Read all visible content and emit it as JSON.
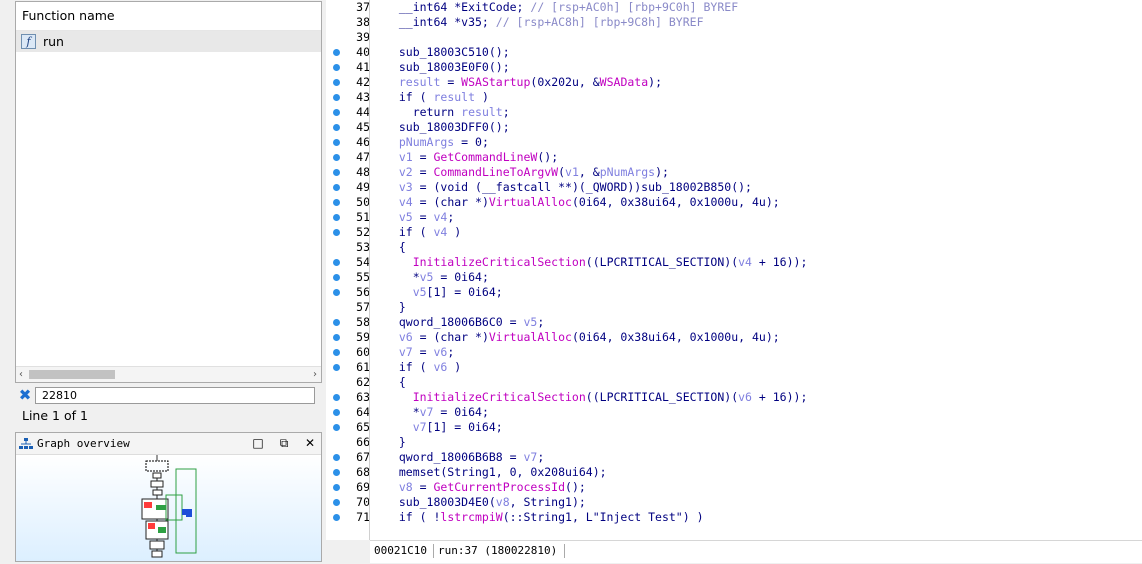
{
  "function_list": {
    "header": "Function name",
    "items": [
      {
        "name": "run",
        "icon": "function-icon"
      }
    ]
  },
  "search": {
    "value": "22810"
  },
  "line_info": "Line 1 of 1",
  "graph_overview": {
    "title": "Graph overview",
    "buttons": [
      "maximize",
      "restore",
      "close"
    ]
  },
  "status_bar": {
    "offset": "00021C10",
    "position": "run:37 (180022810)"
  },
  "colors": {
    "keyword": "#000080",
    "comment": "#8a8ac8",
    "variable": "#7f7fdf",
    "api": "#c000c0",
    "breakpoint": "#2b90e8"
  },
  "code_lines": [
    {
      "n": "37",
      "dot": false,
      "seg": [
        [
          "p",
          "  __int64 *ExitCode; "
        ],
        [
          "c",
          "// [rsp+AC0h] [rbp+9C0h] BYREF"
        ]
      ]
    },
    {
      "n": "38",
      "dot": false,
      "seg": [
        [
          "p",
          "  __int64 *v35; "
        ],
        [
          "c",
          "// [rsp+AC8h] [rbp+9C8h] BYREF"
        ]
      ]
    },
    {
      "n": "39",
      "dot": false,
      "seg": []
    },
    {
      "n": "40",
      "dot": true,
      "seg": [
        [
          "p",
          "  sub_18003C510();"
        ]
      ]
    },
    {
      "n": "41",
      "dot": true,
      "seg": [
        [
          "p",
          "  sub_18003E0F0();"
        ]
      ]
    },
    {
      "n": "42",
      "dot": true,
      "seg": [
        [
          "v",
          "  result"
        ],
        [
          "p",
          " = "
        ],
        [
          "f",
          "WSAStartup"
        ],
        [
          "p",
          "(0x202u, &"
        ],
        [
          "f",
          "WSAData"
        ],
        [
          "p",
          ");"
        ]
      ]
    },
    {
      "n": "43",
      "dot": true,
      "seg": [
        [
          "p",
          "  if ( "
        ],
        [
          "v",
          "result"
        ],
        [
          "p",
          " )"
        ]
      ]
    },
    {
      "n": "44",
      "dot": true,
      "seg": [
        [
          "p",
          "    return "
        ],
        [
          "v",
          "result"
        ],
        [
          "p",
          ";"
        ]
      ]
    },
    {
      "n": "45",
      "dot": true,
      "seg": [
        [
          "p",
          "  sub_18003DFF0();"
        ]
      ]
    },
    {
      "n": "46",
      "dot": true,
      "seg": [
        [
          "v",
          "  pNumArgs"
        ],
        [
          "p",
          " = 0;"
        ]
      ]
    },
    {
      "n": "47",
      "dot": true,
      "seg": [
        [
          "v",
          "  v1"
        ],
        [
          "p",
          " = "
        ],
        [
          "f",
          "GetCommandLineW"
        ],
        [
          "p",
          "();"
        ]
      ]
    },
    {
      "n": "48",
      "dot": true,
      "seg": [
        [
          "v",
          "  v2"
        ],
        [
          "p",
          " = "
        ],
        [
          "f",
          "CommandLineToArgvW"
        ],
        [
          "p",
          "("
        ],
        [
          "v",
          "v1"
        ],
        [
          "p",
          ", &"
        ],
        [
          "v",
          "pNumArgs"
        ],
        [
          "p",
          ");"
        ]
      ]
    },
    {
      "n": "49",
      "dot": true,
      "seg": [
        [
          "v",
          "  v3"
        ],
        [
          "p",
          " = (void (__fastcall **)(_QWORD))sub_18002B850();"
        ]
      ]
    },
    {
      "n": "50",
      "dot": true,
      "seg": [
        [
          "v",
          "  v4"
        ],
        [
          "p",
          " = (char *)"
        ],
        [
          "f",
          "VirtualAlloc"
        ],
        [
          "p",
          "(0i64, 0x38ui64, 0x1000u, 4u);"
        ]
      ]
    },
    {
      "n": "51",
      "dot": true,
      "seg": [
        [
          "v",
          "  v5"
        ],
        [
          "p",
          " = "
        ],
        [
          "v",
          "v4"
        ],
        [
          "p",
          ";"
        ]
      ]
    },
    {
      "n": "52",
      "dot": true,
      "seg": [
        [
          "p",
          "  if ( "
        ],
        [
          "v",
          "v4"
        ],
        [
          "p",
          " )"
        ]
      ]
    },
    {
      "n": "53",
      "dot": false,
      "seg": [
        [
          "p",
          "  {"
        ]
      ]
    },
    {
      "n": "54",
      "dot": true,
      "seg": [
        [
          "f",
          "    InitializeCriticalSection"
        ],
        [
          "p",
          "((LPCRITICAL_SECTION)("
        ],
        [
          "v",
          "v4"
        ],
        [
          "p",
          " + 16));"
        ]
      ]
    },
    {
      "n": "55",
      "dot": true,
      "seg": [
        [
          "p",
          "    *"
        ],
        [
          "v",
          "v5"
        ],
        [
          "p",
          " = 0i64;"
        ]
      ]
    },
    {
      "n": "56",
      "dot": true,
      "seg": [
        [
          "v",
          "    v5"
        ],
        [
          "p",
          "[1] = 0i64;"
        ]
      ]
    },
    {
      "n": "57",
      "dot": false,
      "seg": [
        [
          "p",
          "  }"
        ]
      ]
    },
    {
      "n": "58",
      "dot": true,
      "seg": [
        [
          "p",
          "  qword_18006B6C0 = "
        ],
        [
          "v",
          "v5"
        ],
        [
          "p",
          ";"
        ]
      ]
    },
    {
      "n": "59",
      "dot": true,
      "seg": [
        [
          "v",
          "  v6"
        ],
        [
          "p",
          " = (char *)"
        ],
        [
          "f",
          "VirtualAlloc"
        ],
        [
          "p",
          "(0i64, 0x38ui64, 0x1000u, 4u);"
        ]
      ]
    },
    {
      "n": "60",
      "dot": true,
      "seg": [
        [
          "v",
          "  v7"
        ],
        [
          "p",
          " = "
        ],
        [
          "v",
          "v6"
        ],
        [
          "p",
          ";"
        ]
      ]
    },
    {
      "n": "61",
      "dot": true,
      "seg": [
        [
          "p",
          "  if ( "
        ],
        [
          "v",
          "v6"
        ],
        [
          "p",
          " )"
        ]
      ]
    },
    {
      "n": "62",
      "dot": false,
      "seg": [
        [
          "p",
          "  {"
        ]
      ]
    },
    {
      "n": "63",
      "dot": true,
      "seg": [
        [
          "f",
          "    InitializeCriticalSection"
        ],
        [
          "p",
          "((LPCRITICAL_SECTION)("
        ],
        [
          "v",
          "v6"
        ],
        [
          "p",
          " + 16));"
        ]
      ]
    },
    {
      "n": "64",
      "dot": true,
      "seg": [
        [
          "p",
          "    *"
        ],
        [
          "v",
          "v7"
        ],
        [
          "p",
          " = 0i64;"
        ]
      ]
    },
    {
      "n": "65",
      "dot": true,
      "seg": [
        [
          "v",
          "    v7"
        ],
        [
          "p",
          "[1] = 0i64;"
        ]
      ]
    },
    {
      "n": "66",
      "dot": false,
      "seg": [
        [
          "p",
          "  }"
        ]
      ]
    },
    {
      "n": "67",
      "dot": true,
      "seg": [
        [
          "p",
          "  qword_18006B6B8 = "
        ],
        [
          "v",
          "v7"
        ],
        [
          "p",
          ";"
        ]
      ]
    },
    {
      "n": "68",
      "dot": true,
      "seg": [
        [
          "p",
          "  memset(String1, 0, 0x208ui64);"
        ]
      ]
    },
    {
      "n": "69",
      "dot": true,
      "seg": [
        [
          "v",
          "  v8"
        ],
        [
          "p",
          " = "
        ],
        [
          "f",
          "GetCurrentProcessId"
        ],
        [
          "p",
          "();"
        ]
      ]
    },
    {
      "n": "70",
      "dot": true,
      "seg": [
        [
          "p",
          "  sub_18003D4E0("
        ],
        [
          "v",
          "v8"
        ],
        [
          "p",
          ", String1);"
        ]
      ]
    },
    {
      "n": "71",
      "dot": true,
      "seg": [
        [
          "p",
          "  if ( !"
        ],
        [
          "f",
          "lstrcmpiW"
        ],
        [
          "p",
          "(::String1, L\"Inject Test\") )"
        ]
      ]
    }
  ]
}
